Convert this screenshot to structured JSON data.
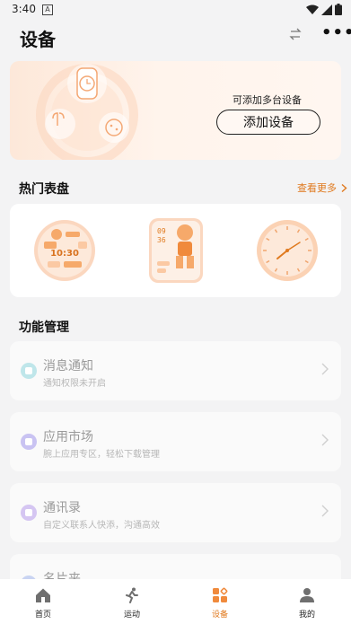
{
  "status_bar": {
    "time": "3:40",
    "badge": "A"
  },
  "header": {
    "title": "设备",
    "swap_icon": "swap-arrows-icon",
    "more_icon": "more-dots-icon",
    "more_glyph": "•••"
  },
  "banner": {
    "subtitle": "可添加多台设备",
    "add_button": "添加设备"
  },
  "watch_faces": {
    "title": "热门表盘",
    "more_link": "查看更多",
    "face1": {
      "time": "10:30"
    },
    "face2": {
      "hour": "09",
      "minute": "36"
    }
  },
  "features": {
    "title": "功能管理",
    "items": [
      {
        "name": "消息通知",
        "desc": "通知权限未开启",
        "color": "#bfe6ea"
      },
      {
        "name": "应用市场",
        "desc": "腕上应用专区，轻松下载管理",
        "color": "#c9c3f2"
      },
      {
        "name": "通讯录",
        "desc": "自定义联系人快添，沟通高效",
        "color": "#d5c6f2"
      },
      {
        "name": "名片夹",
        "desc": "",
        "color": "#c9d4f2"
      }
    ]
  },
  "tabs": [
    {
      "label": "首页",
      "icon": "home-icon",
      "active": false
    },
    {
      "label": "运动",
      "icon": "running-icon",
      "active": false
    },
    {
      "label": "设备",
      "icon": "device-grid-icon",
      "active": true
    },
    {
      "label": "我的",
      "icon": "profile-icon",
      "active": false
    }
  ],
  "colors": {
    "accent": "#e07a1f",
    "banner_bg": "#fde8d9",
    "face_orange": "#f6a96a"
  }
}
